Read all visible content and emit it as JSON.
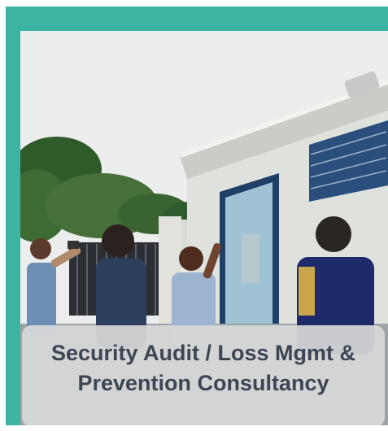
{
  "card": {
    "title": "Security Audit / Loss Mgmt & Prevention Consultancy",
    "accent_color": "#3cb4a4",
    "photo": "people-inspecting-building-photo"
  }
}
